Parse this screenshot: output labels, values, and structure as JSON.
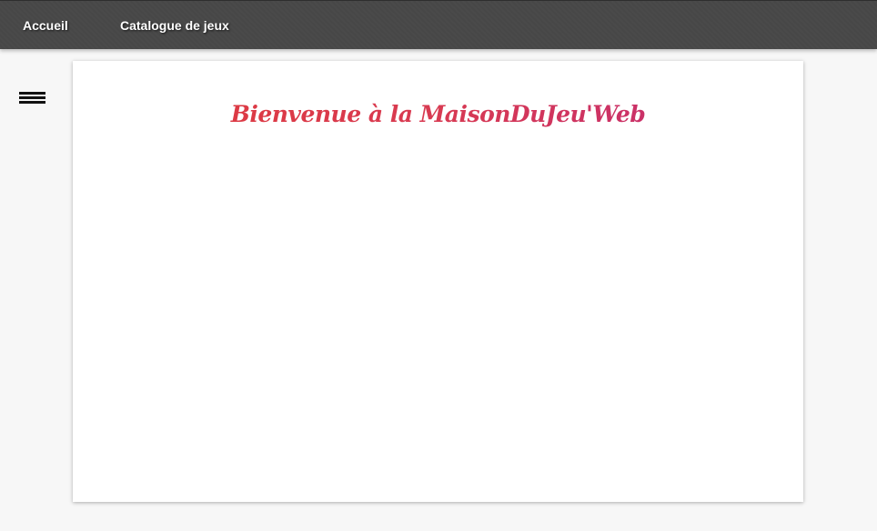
{
  "navbar": {
    "links": [
      {
        "label": "Accueil"
      },
      {
        "label": "Catalogue de jeux"
      }
    ]
  },
  "menu": {
    "icon": "hamburger-menu-icon"
  },
  "main": {
    "title": "Bienvenue à la MaisonDuJeu'Web"
  },
  "colors": {
    "navbar_bg": "#4a4a4a",
    "title_start": "#e03a3a",
    "title_end": "#c02a78",
    "page_bg": "#f7f7f7",
    "card_bg": "#ffffff"
  }
}
